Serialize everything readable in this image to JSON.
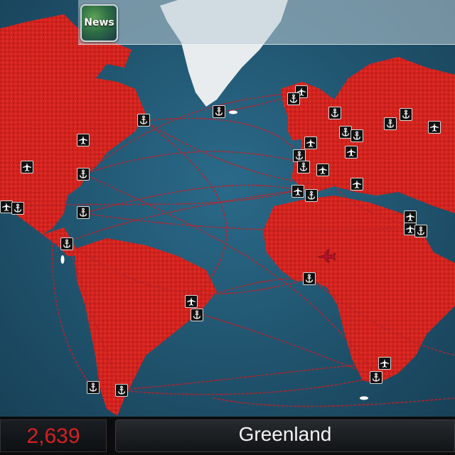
{
  "header": {
    "news_button_label": "News"
  },
  "status": {
    "counter_value": "2,639",
    "selected_country": "Greenland"
  },
  "colors": {
    "ocean": "#1f5674",
    "infected_land": "#d3231e",
    "uninfected_land": "#e9ecef",
    "counter_text": "#d42121",
    "country_text": "#f3f3f3",
    "route_line": "#b8232c"
  },
  "icons": {
    "airport_icon": "airplane",
    "port_icon": "anchor",
    "moving_plane": "red-airplane",
    "ship": "ship"
  }
}
